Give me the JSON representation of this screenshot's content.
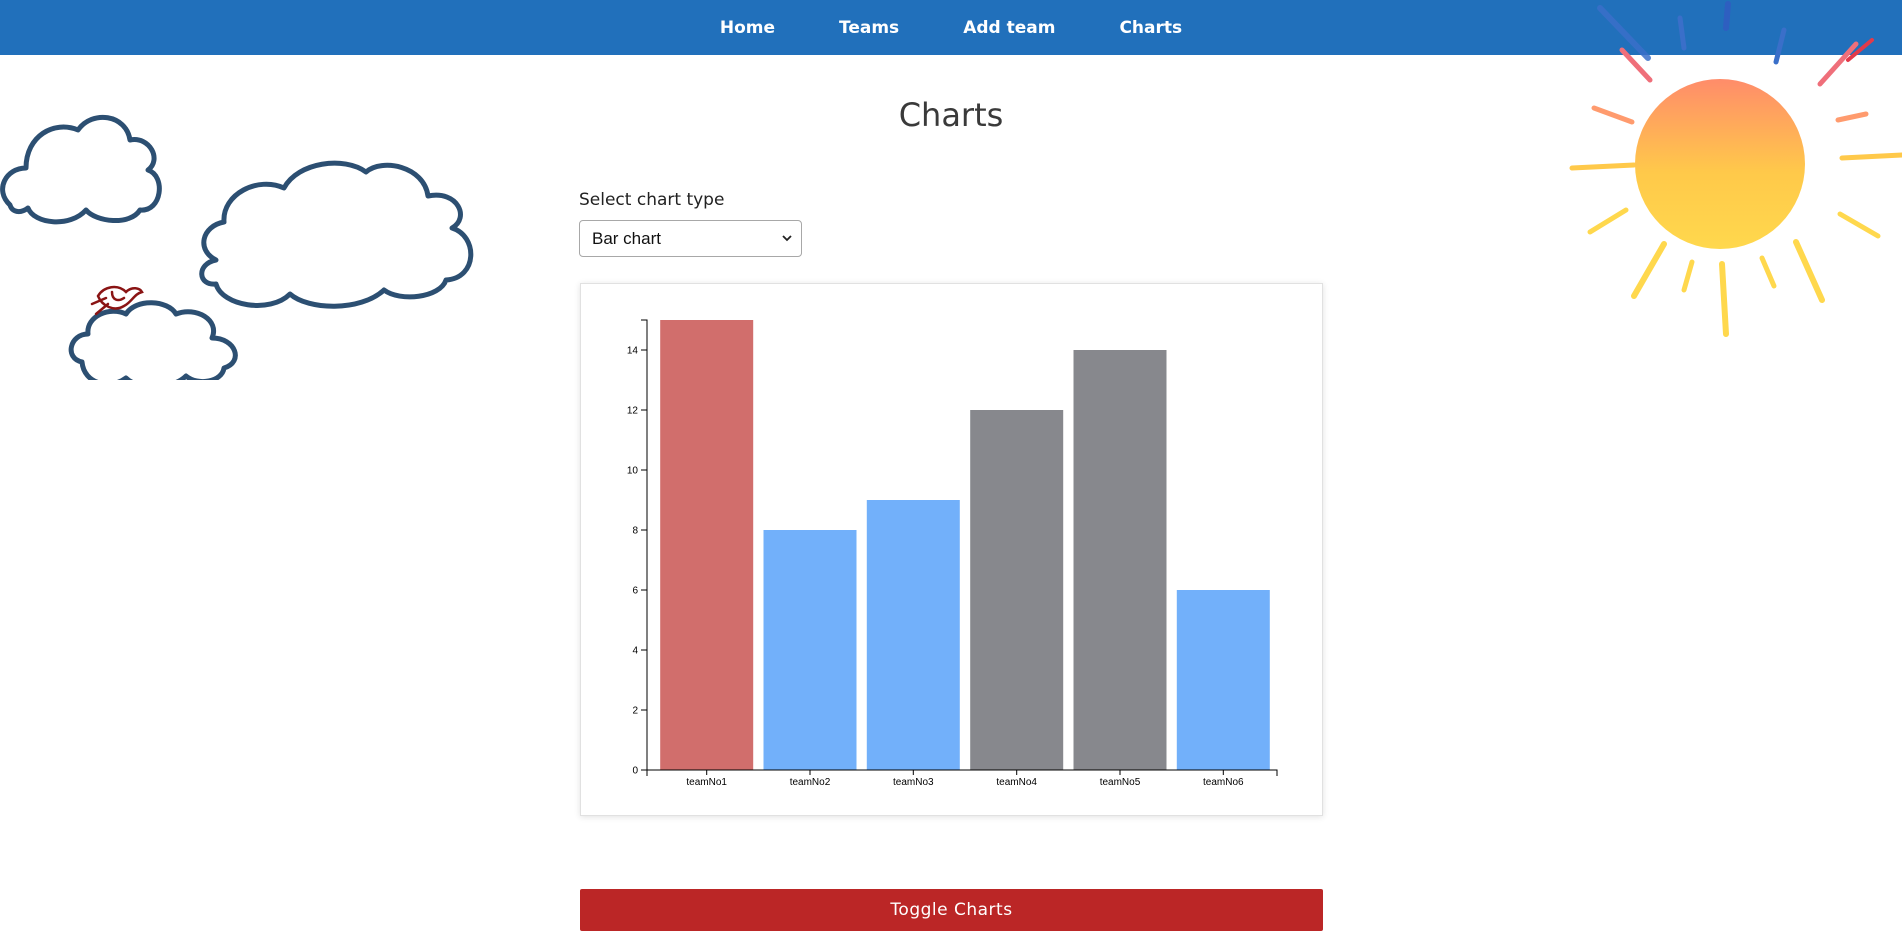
{
  "nav": {
    "items": [
      {
        "label": "Home"
      },
      {
        "label": "Teams"
      },
      {
        "label": "Add team"
      },
      {
        "label": "Charts"
      }
    ]
  },
  "page": {
    "title": "Charts",
    "select_label": "Select chart type",
    "select_value": "Bar chart",
    "toggle_label": "Toggle Charts"
  },
  "colors": {
    "nav_bg": "#2170bb",
    "toggle_bg": "#bb2626",
    "bar_red": "#d16e6c",
    "bar_blue": "#72b0fa",
    "bar_gray": "#87888d"
  },
  "chart_data": {
    "type": "bar",
    "categories": [
      "teamNo1",
      "teamNo2",
      "teamNo3",
      "teamNo4",
      "teamNo5",
      "teamNo6"
    ],
    "values": [
      15,
      8,
      9,
      12,
      14,
      6
    ],
    "bar_colors": [
      "#d16e6c",
      "#72b0fa",
      "#72b0fa",
      "#87888d",
      "#87888d",
      "#72b0fa"
    ],
    "ylim": [
      0,
      15
    ],
    "yticks": [
      0,
      2,
      4,
      6,
      8,
      10,
      12,
      14
    ],
    "grid": false,
    "title": "",
    "xlabel": "",
    "ylabel": ""
  }
}
